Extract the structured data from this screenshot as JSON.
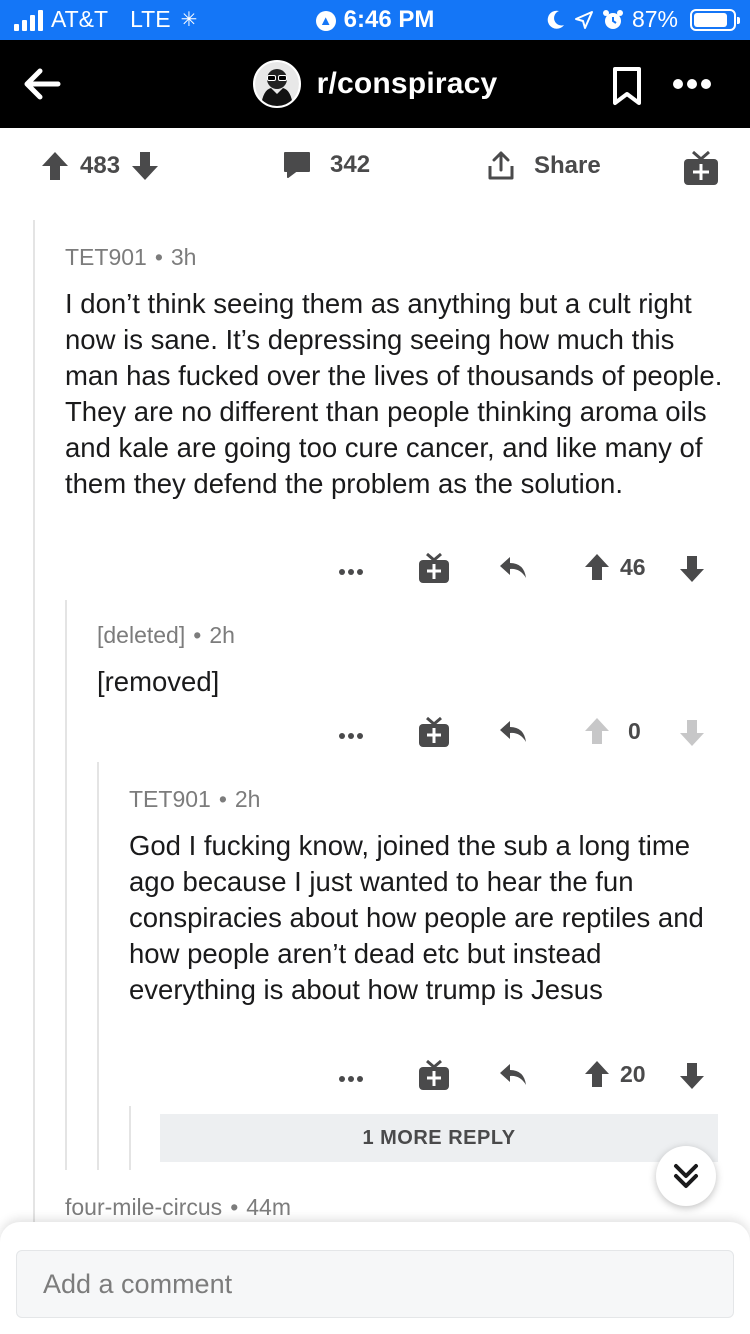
{
  "status_bar": {
    "carrier": "AT&T",
    "network": "LTE",
    "time": "6:46 PM",
    "battery": "87%",
    "battery_level": 0.87,
    "background_color": "#1476f7"
  },
  "header": {
    "subreddit": "r/conspiracy",
    "icons": [
      "back-arrow-icon",
      "subreddit-avatar",
      "bookmark-icon",
      "more-icon"
    ]
  },
  "post_bar": {
    "score": "483",
    "comments": "342",
    "share_label": "Share"
  },
  "comments": [
    {
      "author": "TET901",
      "age": "3h",
      "body": "I don’t think seeing them as anything but a cult right now is sane. It’s depressing seeing how much this man has fucked over the lives of thousands of people. They are no different than people thinking aroma oils and kale are going too cure cancer, and like many of them they defend the problem as the solution.",
      "score": "46"
    },
    {
      "author": "[deleted]",
      "age": "2h",
      "body": "[removed]",
      "score": "0"
    },
    {
      "author": "TET901",
      "age": "2h",
      "body": "God I fucking know,  joined the sub a long time ago because I just wanted to hear the fun conspiracies about how people are reptiles and how people aren’t dead etc but instead everything is about how trump is Jesus",
      "score": "20"
    },
    {
      "author": "four-mile-circus",
      "age": "44m"
    }
  ],
  "more_replies_label": "1 MORE REPLY",
  "composer": {
    "placeholder": "Add a comment"
  },
  "colors": {
    "header_bg": "#000000",
    "thread_line": "#e4e4e4",
    "meta_text": "#7c7c7c"
  }
}
